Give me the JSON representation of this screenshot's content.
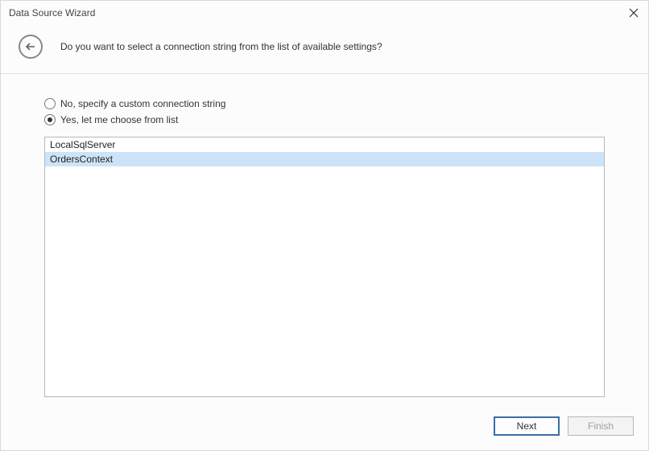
{
  "window": {
    "title": "Data Source Wizard"
  },
  "header": {
    "question": "Do you want to select a connection string from the list of available settings?"
  },
  "options": {
    "custom": {
      "label": "No, specify a custom connection string",
      "selected": false
    },
    "list": {
      "label": "Yes, let me choose from list",
      "selected": true
    }
  },
  "connections": {
    "items": [
      {
        "label": "LocalSqlServer",
        "selected": false
      },
      {
        "label": "OrdersContext",
        "selected": true
      }
    ]
  },
  "footer": {
    "next": "Next",
    "finish": "Finish"
  }
}
